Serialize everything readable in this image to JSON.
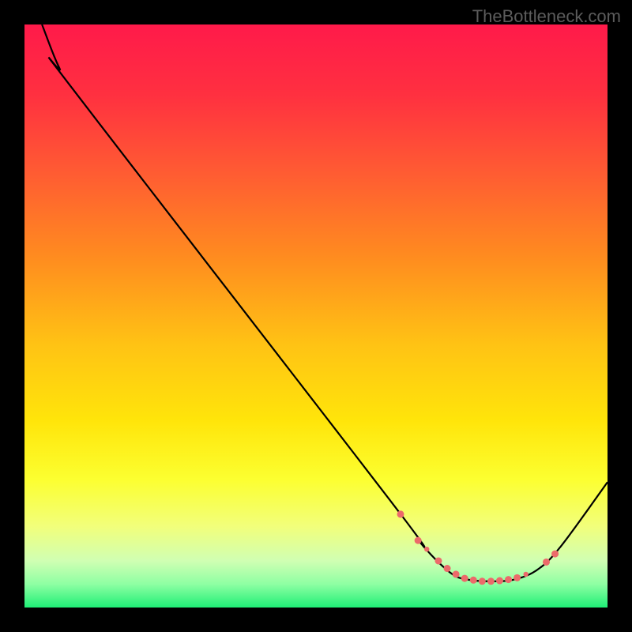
{
  "watermark": "TheBottleneck.com",
  "chart_data": {
    "type": "line",
    "title": "",
    "xlabel": "",
    "ylabel": "",
    "xlim": [
      0,
      100
    ],
    "ylim": [
      0,
      100
    ],
    "background_gradient": {
      "stops": [
        {
          "offset": 0.0,
          "color": "#ff1a4a"
        },
        {
          "offset": 0.12,
          "color": "#ff3040"
        },
        {
          "offset": 0.25,
          "color": "#ff5a33"
        },
        {
          "offset": 0.4,
          "color": "#ff8c1f"
        },
        {
          "offset": 0.55,
          "color": "#ffc314"
        },
        {
          "offset": 0.68,
          "color": "#ffe50a"
        },
        {
          "offset": 0.78,
          "color": "#fcff30"
        },
        {
          "offset": 0.86,
          "color": "#f2ff7a"
        },
        {
          "offset": 0.92,
          "color": "#d0ffb3"
        },
        {
          "offset": 0.96,
          "color": "#8effa3"
        },
        {
          "offset": 1.0,
          "color": "#1fef76"
        }
      ]
    },
    "curve": {
      "comment": "y is percentage height from top (0=top, 100=bottom). Curve descends from top-left, bottoms out around x≈75-85, rises toward right.",
      "points": [
        {
          "x": 3.0,
          "y": 0.0
        },
        {
          "x": 6.0,
          "y": 7.5
        },
        {
          "x": 9.0,
          "y": 12.0
        },
        {
          "x": 63.0,
          "y": 82.0
        },
        {
          "x": 68.0,
          "y": 89.0
        },
        {
          "x": 73.0,
          "y": 94.0
        },
        {
          "x": 76.0,
          "y": 95.2
        },
        {
          "x": 80.0,
          "y": 95.5
        },
        {
          "x": 84.0,
          "y": 95.2
        },
        {
          "x": 88.0,
          "y": 93.5
        },
        {
          "x": 92.0,
          "y": 89.5
        },
        {
          "x": 100.0,
          "y": 78.5
        }
      ]
    },
    "markers": {
      "color": "#ec6a6a",
      "radius_small": 3.2,
      "radius_mid": 4.5,
      "points": [
        {
          "x": 64.5,
          "y": 84.0,
          "r": 4.5
        },
        {
          "x": 67.5,
          "y": 88.5,
          "r": 4.5
        },
        {
          "x": 69.0,
          "y": 90.0,
          "r": 3.2
        },
        {
          "x": 71.0,
          "y": 92.0,
          "r": 4.5
        },
        {
          "x": 72.5,
          "y": 93.3,
          "r": 4.5
        },
        {
          "x": 74.0,
          "y": 94.3,
          "r": 4.5
        },
        {
          "x": 75.5,
          "y": 95.0,
          "r": 4.5
        },
        {
          "x": 77.0,
          "y": 95.3,
          "r": 4.5
        },
        {
          "x": 78.5,
          "y": 95.5,
          "r": 4.5
        },
        {
          "x": 80.0,
          "y": 95.5,
          "r": 4.5
        },
        {
          "x": 81.5,
          "y": 95.4,
          "r": 4.5
        },
        {
          "x": 83.0,
          "y": 95.2,
          "r": 4.5
        },
        {
          "x": 84.5,
          "y": 94.9,
          "r": 4.5
        },
        {
          "x": 86.0,
          "y": 94.3,
          "r": 3.2
        },
        {
          "x": 89.5,
          "y": 92.2,
          "r": 4.5
        },
        {
          "x": 91.0,
          "y": 90.8,
          "r": 4.5
        }
      ]
    }
  }
}
